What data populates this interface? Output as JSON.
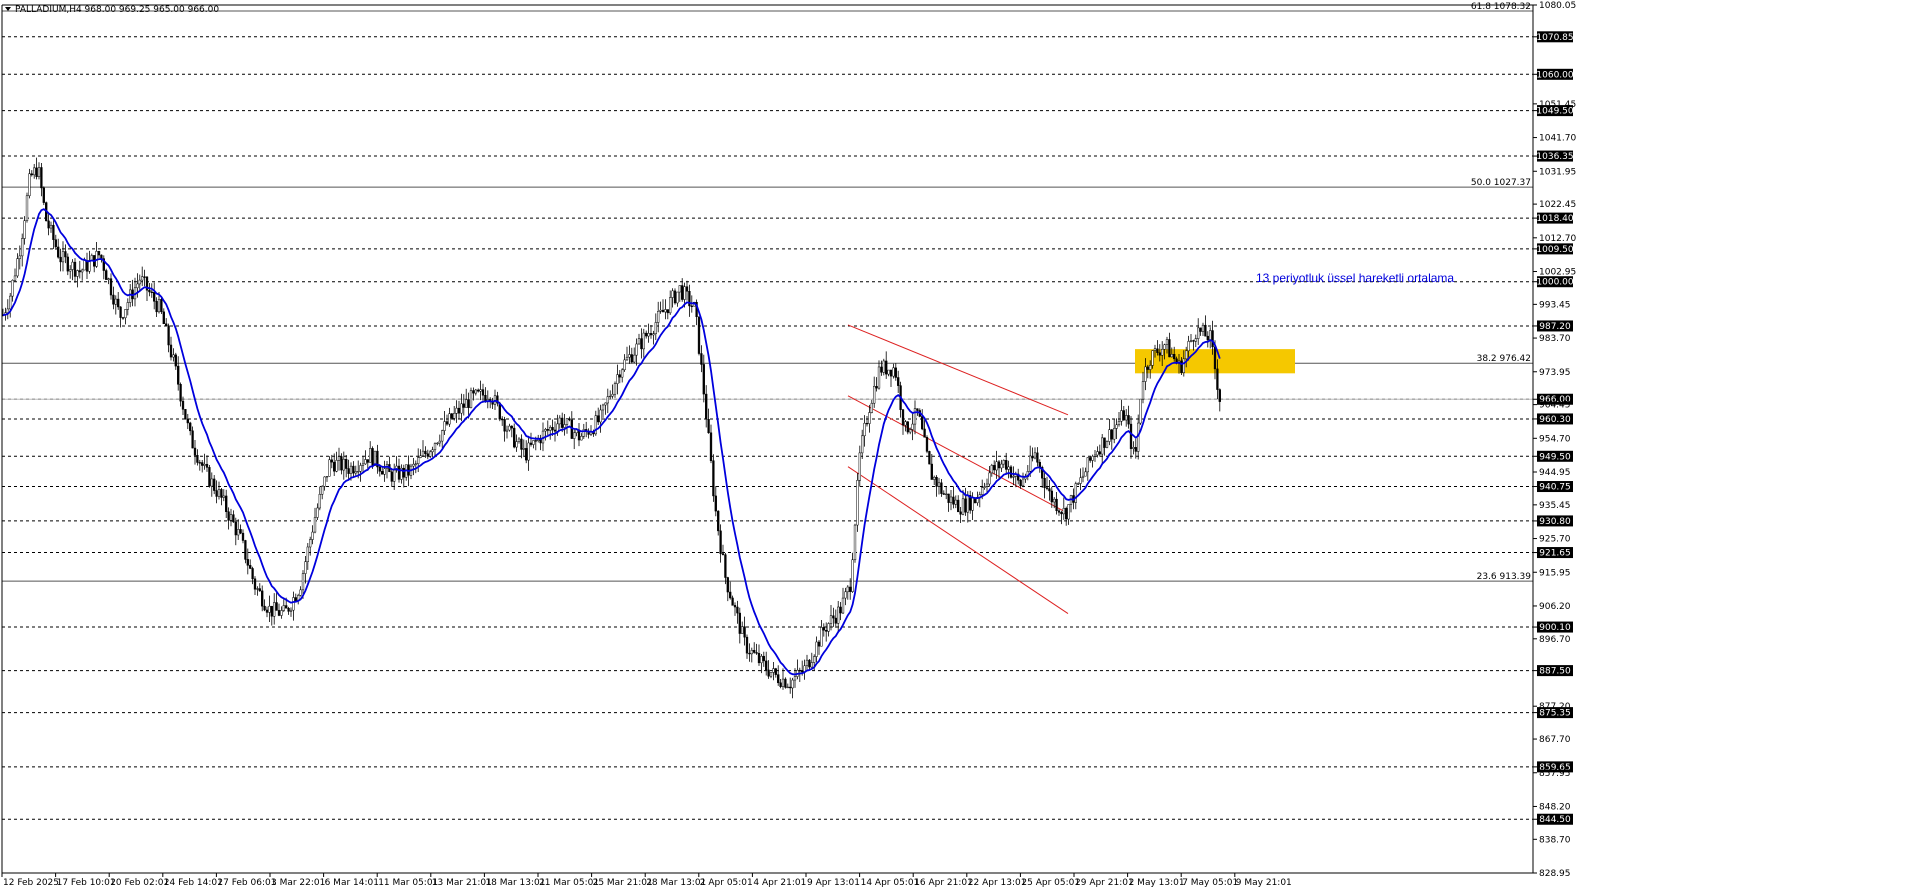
{
  "header": {
    "symbol_line": "PALLADIUM,H4  968.00 969.25 965.00 966.00"
  },
  "chart_data": {
    "type": "candlestick",
    "symbol": "PALLADIUM",
    "timeframe": "H4",
    "ohlc_current": {
      "open": 968.0,
      "high": 969.25,
      "low": 965.0,
      "close": 966.0
    },
    "ylim": [
      828.95,
      1080.05
    ],
    "grid": false,
    "y_ticks": [
      "1080.05",
      "1070.85",
      "1060.00",
      "1051.45",
      "1049.50",
      "1041.70",
      "1036.35",
      "1031.95",
      "1022.45",
      "1018.40",
      "1012.70",
      "1009.50",
      "1002.95",
      "1000.00",
      "993.45",
      "987.20",
      "983.70",
      "973.95",
      "966.00",
      "964.45",
      "960.30",
      "954.70",
      "949.50",
      "944.95",
      "940.75",
      "935.45",
      "930.80",
      "925.70",
      "921.65",
      "915.95",
      "906.20",
      "900.10",
      "896.70",
      "887.50",
      "877.20",
      "875.35",
      "867.70",
      "859.65",
      "857.95",
      "848.20",
      "844.50",
      "838.70",
      "828.95"
    ],
    "x_ticks": [
      "12 Feb 2025",
      "17 Feb 10:01",
      "20 Feb 02:01",
      "24 Feb 14:01",
      "27 Feb 06:01",
      "3 Mar 22:01",
      "6 Mar 14:01",
      "11 Mar 05:01",
      "13 Mar 21:01",
      "18 Mar 13:01",
      "21 Mar 05:01",
      "25 Mar 21:01",
      "28 Mar 13:01",
      "2 Apr 05:01",
      "4 Apr 21:01",
      "9 Apr 13:01",
      "14 Apr 05:01",
      "16 Apr 21:01",
      "22 Apr 13:01",
      "25 Apr 05:01",
      "29 Apr 21:01",
      "2 May 13:01",
      "7 May 05:01",
      "9 May 21:01"
    ],
    "horizontal_levels": [
      "1070.85",
      "1060.00",
      "1049.50",
      "1036.35",
      "1018.40",
      "1009.50",
      "1000.00",
      "987.20",
      "966.00",
      "960.30",
      "949.50",
      "940.75",
      "930.80",
      "921.65",
      "900.10",
      "887.50",
      "875.35",
      "859.65",
      "844.50"
    ],
    "fibonacci": [
      {
        "label": "61.8 1078.32",
        "value": 1078.32
      },
      {
        "label": "50.0 1027.37",
        "value": 1027.37
      },
      {
        "label": "38.2 976.42",
        "value": 976.42
      },
      {
        "label": "23.6 913.39",
        "value": 913.39
      }
    ],
    "ema_period": 13,
    "ema_annotation": "13 periyotluk üssel hareketli ortalama",
    "close_anchors": [
      [
        0,
        988
      ],
      [
        10,
        996
      ],
      [
        20,
        1010
      ],
      [
        30,
        1030
      ],
      [
        38,
        1033
      ],
      [
        46,
        1018
      ],
      [
        60,
        1007
      ],
      [
        80,
        1003
      ],
      [
        100,
        1008
      ],
      [
        120,
        990
      ],
      [
        140,
        1001
      ],
      [
        160,
        992
      ],
      [
        175,
        975
      ],
      [
        190,
        955
      ],
      [
        205,
        945
      ],
      [
        220,
        938
      ],
      [
        240,
        926
      ],
      [
        255,
        912
      ],
      [
        270,
        905
      ],
      [
        285,
        904
      ],
      [
        300,
        912
      ],
      [
        315,
        932
      ],
      [
        330,
        948
      ],
      [
        350,
        946
      ],
      [
        370,
        950
      ],
      [
        390,
        944
      ],
      [
        410,
        945
      ],
      [
        430,
        952
      ],
      [
        450,
        960
      ],
      [
        470,
        966
      ],
      [
        490,
        968
      ],
      [
        510,
        956
      ],
      [
        525,
        950
      ],
      [
        540,
        955
      ],
      [
        560,
        960
      ],
      [
        580,
        955
      ],
      [
        600,
        960
      ],
      [
        620,
        975
      ],
      [
        640,
        982
      ],
      [
        660,
        990
      ],
      [
        680,
        998
      ],
      [
        695,
        992
      ],
      [
        705,
        965
      ],
      [
        715,
        935
      ],
      [
        725,
        915
      ],
      [
        745,
        895
      ],
      [
        760,
        890
      ],
      [
        775,
        886
      ],
      [
        790,
        884
      ],
      [
        805,
        888
      ],
      [
        825,
        900
      ],
      [
        840,
        905
      ],
      [
        850,
        912
      ],
      [
        860,
        950
      ],
      [
        870,
        965
      ],
      [
        880,
        975
      ],
      [
        895,
        975
      ],
      [
        905,
        957
      ],
      [
        918,
        962
      ],
      [
        930,
        945
      ],
      [
        945,
        938
      ],
      [
        960,
        935
      ],
      [
        975,
        937
      ],
      [
        990,
        945
      ],
      [
        1005,
        948
      ],
      [
        1020,
        941
      ],
      [
        1035,
        950
      ],
      [
        1050,
        938
      ],
      [
        1065,
        933
      ],
      [
        1080,
        942
      ],
      [
        1095,
        951
      ],
      [
        1110,
        956
      ],
      [
        1125,
        962
      ],
      [
        1135,
        948
      ],
      [
        1142,
        972
      ],
      [
        1150,
        978
      ],
      [
        1165,
        982
      ],
      [
        1180,
        975
      ],
      [
        1195,
        986
      ],
      [
        1210,
        984
      ],
      [
        1220,
        966
      ]
    ],
    "channel": {
      "upper": [
        [
          848,
          987.5
        ],
        [
          1068,
          961.5
        ]
      ],
      "lower": [
        [
          848,
          946.5
        ],
        [
          1068,
          904.0
        ]
      ],
      "middle": [
        [
          848,
          967.0
        ],
        [
          1068,
          933.0
        ]
      ]
    },
    "highlight_zone": {
      "from": 973.5,
      "to": 980.5
    },
    "colors": {
      "ema": "#0000dd",
      "channel": "#dd2222",
      "zone": "#f5c800",
      "level_label_bg": "#000000",
      "candle": "#000000"
    }
  }
}
